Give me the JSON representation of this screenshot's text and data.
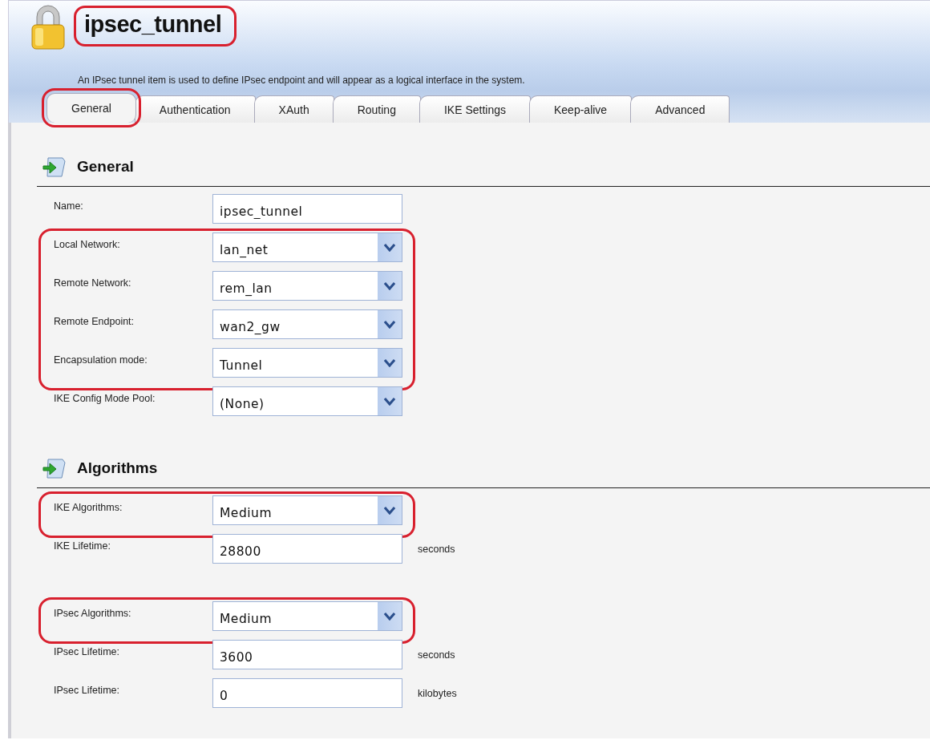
{
  "header": {
    "title": "ipsec_tunnel",
    "title_highlighted": true,
    "description": "An IPsec tunnel item is used to define IPsec endpoint and will appear as a logical interface in the system."
  },
  "tabs": [
    {
      "label": "General",
      "selected": true,
      "highlighted": true
    },
    {
      "label": "Authentication",
      "selected": false,
      "highlighted": false
    },
    {
      "label": "XAuth",
      "selected": false,
      "highlighted": false
    },
    {
      "label": "Routing",
      "selected": false,
      "highlighted": false
    },
    {
      "label": "IKE Settings",
      "selected": false,
      "highlighted": false
    },
    {
      "label": "Keep-alive",
      "selected": false,
      "highlighted": false
    },
    {
      "label": "Advanced",
      "selected": false,
      "highlighted": false
    }
  ],
  "sections": [
    {
      "title": "General",
      "groups": [
        {
          "highlighted": false,
          "fields": [
            {
              "kind": "text",
              "label": "Name:",
              "value": "ipsec_tunnel"
            }
          ]
        },
        {
          "highlighted": true,
          "fields": [
            {
              "kind": "select",
              "label": "Local Network:",
              "value": "lan_net"
            },
            {
              "kind": "select",
              "label": "Remote Network:",
              "value": "rem_lan"
            },
            {
              "kind": "select",
              "label": "Remote Endpoint:",
              "value": "wan2_gw"
            },
            {
              "kind": "select",
              "label": "Encapsulation mode:",
              "value": "Tunnel"
            }
          ]
        },
        {
          "highlighted": false,
          "fields": [
            {
              "kind": "select",
              "label": "IKE Config Mode Pool:",
              "value": "(None)"
            }
          ]
        }
      ]
    },
    {
      "title": "Algorithms",
      "groups": [
        {
          "highlighted": true,
          "fields": [
            {
              "kind": "select",
              "label": "IKE Algorithms:",
              "value": "Medium"
            }
          ]
        },
        {
          "highlighted": false,
          "fields": [
            {
              "kind": "text",
              "label": "IKE Lifetime:",
              "value": "28800",
              "unit": "seconds"
            }
          ]
        },
        {
          "highlighted": true,
          "fields": [
            {
              "kind": "select",
              "label": "IPsec Algorithms:",
              "value": "Medium"
            }
          ]
        },
        {
          "highlighted": false,
          "fields": [
            {
              "kind": "text",
              "label": "IPsec Lifetime:",
              "value": "3600",
              "unit": "seconds"
            },
            {
              "kind": "text",
              "label": "IPsec Lifetime:",
              "value": "0",
              "unit": "kilobytes"
            }
          ]
        }
      ]
    }
  ]
}
